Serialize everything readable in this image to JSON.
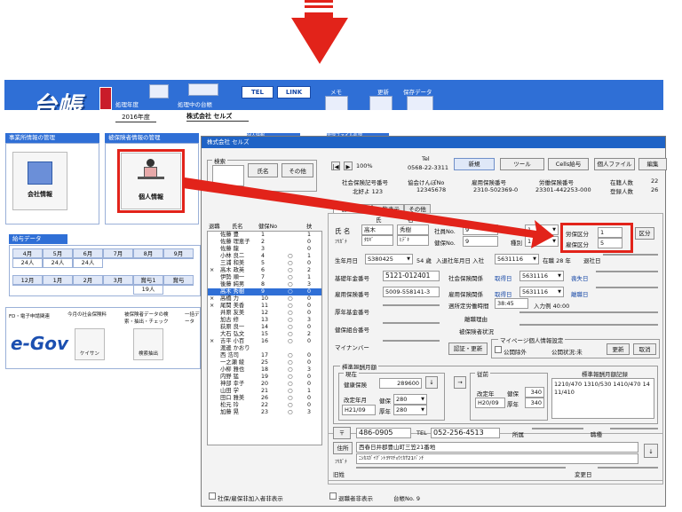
{
  "header": {
    "label_year": "処理年度",
    "label_company": "処理中の台帳",
    "btn_tel": "TEL",
    "btn_link": "LINK",
    "label_memo": "メモ",
    "label_update": "更新",
    "label_save": "保存データ",
    "icon_memo": "MEMO",
    "icon_save": "保存データ",
    "year_value": "2016年度",
    "company_value": "株式会社 セルズ",
    "logo": "台帳"
  },
  "left": {
    "jigyosho_title": "事業所情報の管理",
    "company_info": "会社情報",
    "hihoken_title": "被保険者情報の管理",
    "personal_info": "個人情報",
    "kyuyo_title": "給与データ",
    "months_row1": [
      "4月",
      "5月",
      "6月",
      "7月",
      "8月",
      "9月"
    ],
    "counts_row1": [
      "24人",
      "24人",
      "24人",
      "",
      "",
      ""
    ],
    "months_row2": [
      "12月",
      "1月",
      "2月",
      "3月",
      "賞与1",
      "賞与"
    ],
    "counts_row2": [
      "",
      "",
      "",
      "",
      "19人",
      ""
    ],
    "fd_label": "FD・電子申請関連",
    "egov": "e-Gov",
    "kon_label": "今月の社会保険料",
    "keisan": "ケイサン",
    "hiho_label": "被保険者データの検索・抽出・チェック",
    "kensaku": "検索抽出",
    "ichi_label": "一括データ"
  },
  "win": {
    "title": "株式会社 セルズ",
    "tab_behind_1": "個人情報",
    "tab_behind_2": "管理ファイル処理",
    "search_label": "検索",
    "btn_name": "氏名",
    "btn_other": "その他",
    "list_head": [
      "退職",
      "氏名",
      "健保No",
      "扶"
    ],
    "staff": [
      {
        "r": "",
        "n": "佐藤 豊",
        "k": "1",
        "f": "1",
        "m": ""
      },
      {
        "r": "",
        "n": "佐藤 理恵子",
        "k": "2",
        "f": "0",
        "m": ""
      },
      {
        "r": "",
        "n": "佐藤 龍",
        "k": "3",
        "f": "0",
        "m": ""
      },
      {
        "r": "",
        "n": "小林 良二",
        "k": "4",
        "f": "1",
        "m": "○"
      },
      {
        "r": "",
        "n": "三浦 和美",
        "k": "5",
        "f": "0",
        "m": "○"
      },
      {
        "r": "×",
        "n": "高木 政英",
        "k": "6",
        "f": "2",
        "m": "○"
      },
      {
        "r": "",
        "n": "伊勢 順一",
        "k": "7",
        "f": "1",
        "m": "○"
      },
      {
        "r": "",
        "n": "後藤 純男",
        "k": "8",
        "f": "3",
        "m": "○"
      },
      {
        "r": "",
        "n": "高木 秀樹",
        "k": "9",
        "f": "0",
        "m": "○"
      },
      {
        "r": "×",
        "n": "高橋 力",
        "k": "10",
        "f": "0",
        "m": "○"
      },
      {
        "r": "×",
        "n": "尾関 美香",
        "k": "11",
        "f": "0",
        "m": "○"
      },
      {
        "r": "",
        "n": "井原 友美",
        "k": "12",
        "f": "0",
        "m": "○"
      },
      {
        "r": "",
        "n": "加古 修",
        "k": "13",
        "f": "3",
        "m": "○"
      },
      {
        "r": "",
        "n": "荻原 良一",
        "k": "14",
        "f": "0",
        "m": "○"
      },
      {
        "r": "",
        "n": "大石 弘文",
        "k": "15",
        "f": "2",
        "m": "○"
      },
      {
        "r": "×",
        "n": "吉平 小百",
        "k": "16",
        "f": "0",
        "m": "○"
      },
      {
        "r": "",
        "n": "渡邊 かおり",
        "k": "",
        "f": "",
        "m": ""
      },
      {
        "r": "",
        "n": "西 浩司",
        "k": "17",
        "f": "0",
        "m": "○"
      },
      {
        "r": "",
        "n": "一之瀬 綾",
        "k": "25",
        "f": "0",
        "m": "○"
      },
      {
        "r": "",
        "n": "小柳 雅也",
        "k": "18",
        "f": "3",
        "m": "○"
      },
      {
        "r": "",
        "n": "内野 猛",
        "k": "19",
        "f": "0",
        "m": "○"
      },
      {
        "r": "",
        "n": "神部 幸子",
        "k": "20",
        "f": "0",
        "m": "○"
      },
      {
        "r": "",
        "n": "山田 学",
        "k": "21",
        "f": "1",
        "m": "○"
      },
      {
        "r": "",
        "n": "田口 雅美",
        "k": "26",
        "f": "0",
        "m": "○"
      },
      {
        "r": "",
        "n": "松元 玲",
        "k": "22",
        "f": "0",
        "m": "○"
      },
      {
        "r": "",
        "n": "加藤 晃",
        "k": "23",
        "f": "3",
        "m": "○"
      }
    ],
    "zoom": "100%",
    "tel_label": "Tel",
    "tel_value": "0568-22-3311",
    "btn_new": "新規",
    "btn_tool": "ツール",
    "btn_cells": "Cells給与",
    "btn_file": "個人ファイル",
    "btn_edit": "編集",
    "h_shaho": "社会保険記号番号",
    "h_kyokai": "協会けんぽNo",
    "h_koyo": "雇用保険番号",
    "h_rodo": "労働保険番号",
    "v_shaho": "北好よ 123",
    "v_kyokai": "12345678",
    "v_koyo": "2310-502369-0",
    "v_rodo": "23301-442253-000",
    "zaiseki": "在籍人数",
    "toroku": "登録人数",
    "zaiseki_v": "22",
    "toroku_v": "26",
    "tab_kojin": "個人情報",
    "tab_ichiran": "一覧表示",
    "tab_sonota": "その他",
    "l_shi": "氏",
    "l_mei": "名",
    "l_name": "氏 名",
    "l_furi": "ﾌﾘｶﾞﾅ",
    "sei": "高木",
    "mei": "秀樹",
    "sei_k": "ﾀｶｷﾞ",
    "mei_k": "ﾋﾃﾞｷ",
    "l_shain": "社員No.",
    "shain": "9",
    "l_kenpo": "健保No.",
    "kenpo": "9",
    "l_seibetsu": "性別",
    "seibetsu": "1",
    "l_shubetsu": "種別",
    "shubetsu": "1",
    "l_rohoku": "労保区分",
    "rohoku": "1",
    "l_koyoku": "雇保区分",
    "koyoku": "5",
    "btn_ku": "区分",
    "l_birth": "生年月日",
    "birth": "S380425",
    "age": "54 歳",
    "l_nyusha": "入退社年月日 入社",
    "nyusha": "5631116",
    "zaishoku": "在職 28 年",
    "l_taisha": "退社日",
    "l_kiso": "基礎年金番号",
    "kiso": "5121-012401",
    "l_shakai": "社会保険関係",
    "shutoku": "取得日",
    "shakai_d": "5631116",
    "soshitsu": "喪失日",
    "l_koyoban": "雇用保険番号",
    "koyoban": "5009-558141-3",
    "l_koyokan": "雇用保険関係",
    "koyo_d": "5631116",
    "rishoku": "離職日",
    "l_kosei": "厚年基金番号",
    "l_shuro": "週所定労働時間",
    "shuro": "38:45",
    "nyuryoku": "入力例 40:00",
    "l_kenkokumi": "健保組合番号",
    "l_rishoku_riyu": "離職理由",
    "l_hihoken": "被保険者状況",
    "l_mynumber": "マイナンバー",
    "btn_nintei": "認証・更新",
    "mynumber_set": "マイページ個人情報設定",
    "kokai": "公開除外",
    "kokai_stat": "公開状況:未",
    "btn_koshin": "更新",
    "btn_torikeshi": "取消",
    "hyojun_title": "標準報酬月額",
    "genzai": "現在",
    "l_kenko_ge": "健康保険",
    "kenko_ge": "289600",
    "l_kaitei": "改定年月",
    "kaitei": "H21/09",
    "l_kenpo2": "健保",
    "kenpo2": "280",
    "l_kosei2": "厚年",
    "kosei2": "280",
    "juzen": "従前",
    "juzen_kaitei": "改定年",
    "juzen_date": "H20/09",
    "juzen_kenpo": "340",
    "juzen_kosei": "340",
    "rireki_title": "標準報酬月額記録",
    "rireki": "1210/470 1310/530 1410/470 1411/410",
    "l_zip": "〒",
    "zip": "486-0905",
    "l_tel": "TEL",
    "tel": "052-256-4513",
    "l_shozoku": "所属",
    "l_shokushu": "職種",
    "l_jusho": "住所",
    "jusho": "西春日井郡豊山町三笠21番地",
    "l_furi2": "ﾌﾘｶﾞﾅ",
    "jusho_k": "ﾆｼｶｽｶﾞｲｸﾞﾝﾄﾖﾔﾏﾁｮｳﾐｶｻ21ﾊﾞﾝﾁ",
    "l_kyusei": "旧姓",
    "l_henkobi": "変更日",
    "foot_1": "社保/雇保非加入者非表示",
    "foot_2": "退職者非表示",
    "foot_3": "台帳No. 9"
  },
  "colors": {
    "accent": "#2f6fd6",
    "red": "#e2231a"
  }
}
